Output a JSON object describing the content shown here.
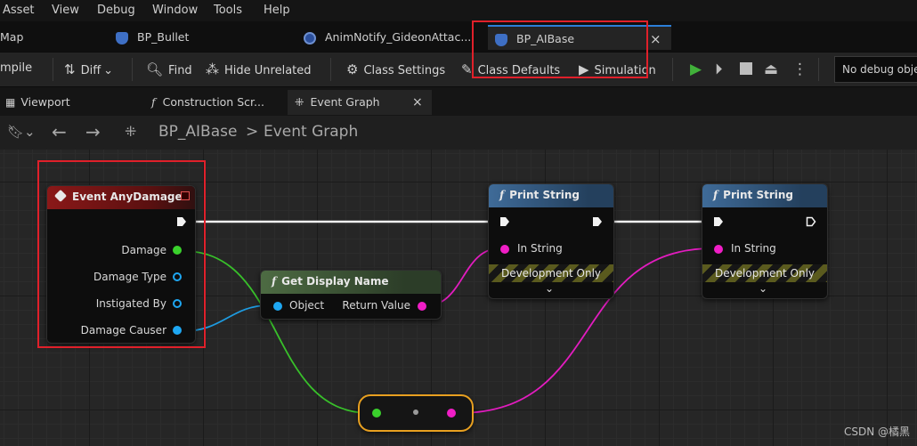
{
  "menu": [
    "Asset",
    "View",
    "Debug",
    "Window",
    "Tools",
    "Help"
  ],
  "asset_tabs": {
    "map_label": "Map",
    "bullet_label": "BP_Bullet",
    "anim_label": "AnimNotify_GideonAttac...",
    "active_label": "BP_AIBase",
    "close_symbol": "×"
  },
  "toolbar": {
    "compile": "mpile",
    "diff": "Diff",
    "find": "Find",
    "hide_unrelated": "Hide Unrelated",
    "class_settings": "Class Settings",
    "class_defaults": "Class Defaults",
    "simulation": "Simulation",
    "debug_object": "No debug object"
  },
  "doc_tabs": {
    "viewport": "Viewport",
    "construction": "Construction Scr...",
    "event_graph": "Event Graph",
    "close_symbol": "×"
  },
  "breadcrumb": {
    "blueprint": "BP_AIBase",
    "separator": ">",
    "graph": "Event Graph"
  },
  "nodes": {
    "event_any_damage": {
      "title": "Event AnyDamage",
      "pins": {
        "damage": "Damage",
        "damage_type": "Damage Type",
        "instigated_by": "Instigated By",
        "damage_causer": "Damage Causer"
      }
    },
    "get_display_name": {
      "title": "Get Display Name",
      "object": "Object",
      "return_value": "Return Value"
    },
    "print_string_1": {
      "title": "Print String",
      "in_string": "In String",
      "dev_only": "Development Only"
    },
    "print_string_2": {
      "title": "Print String",
      "in_string": "In String",
      "dev_only": "Development Only"
    }
  },
  "colors": {
    "accent_blue": "#2b7fd8",
    "highlight_red": "#e0202a",
    "pin_float": "#3ad12c",
    "pin_object": "#1ea7f2",
    "pin_string": "#f01ec6",
    "play_green": "#41b13a"
  },
  "watermark": "CSDN @橘黑"
}
